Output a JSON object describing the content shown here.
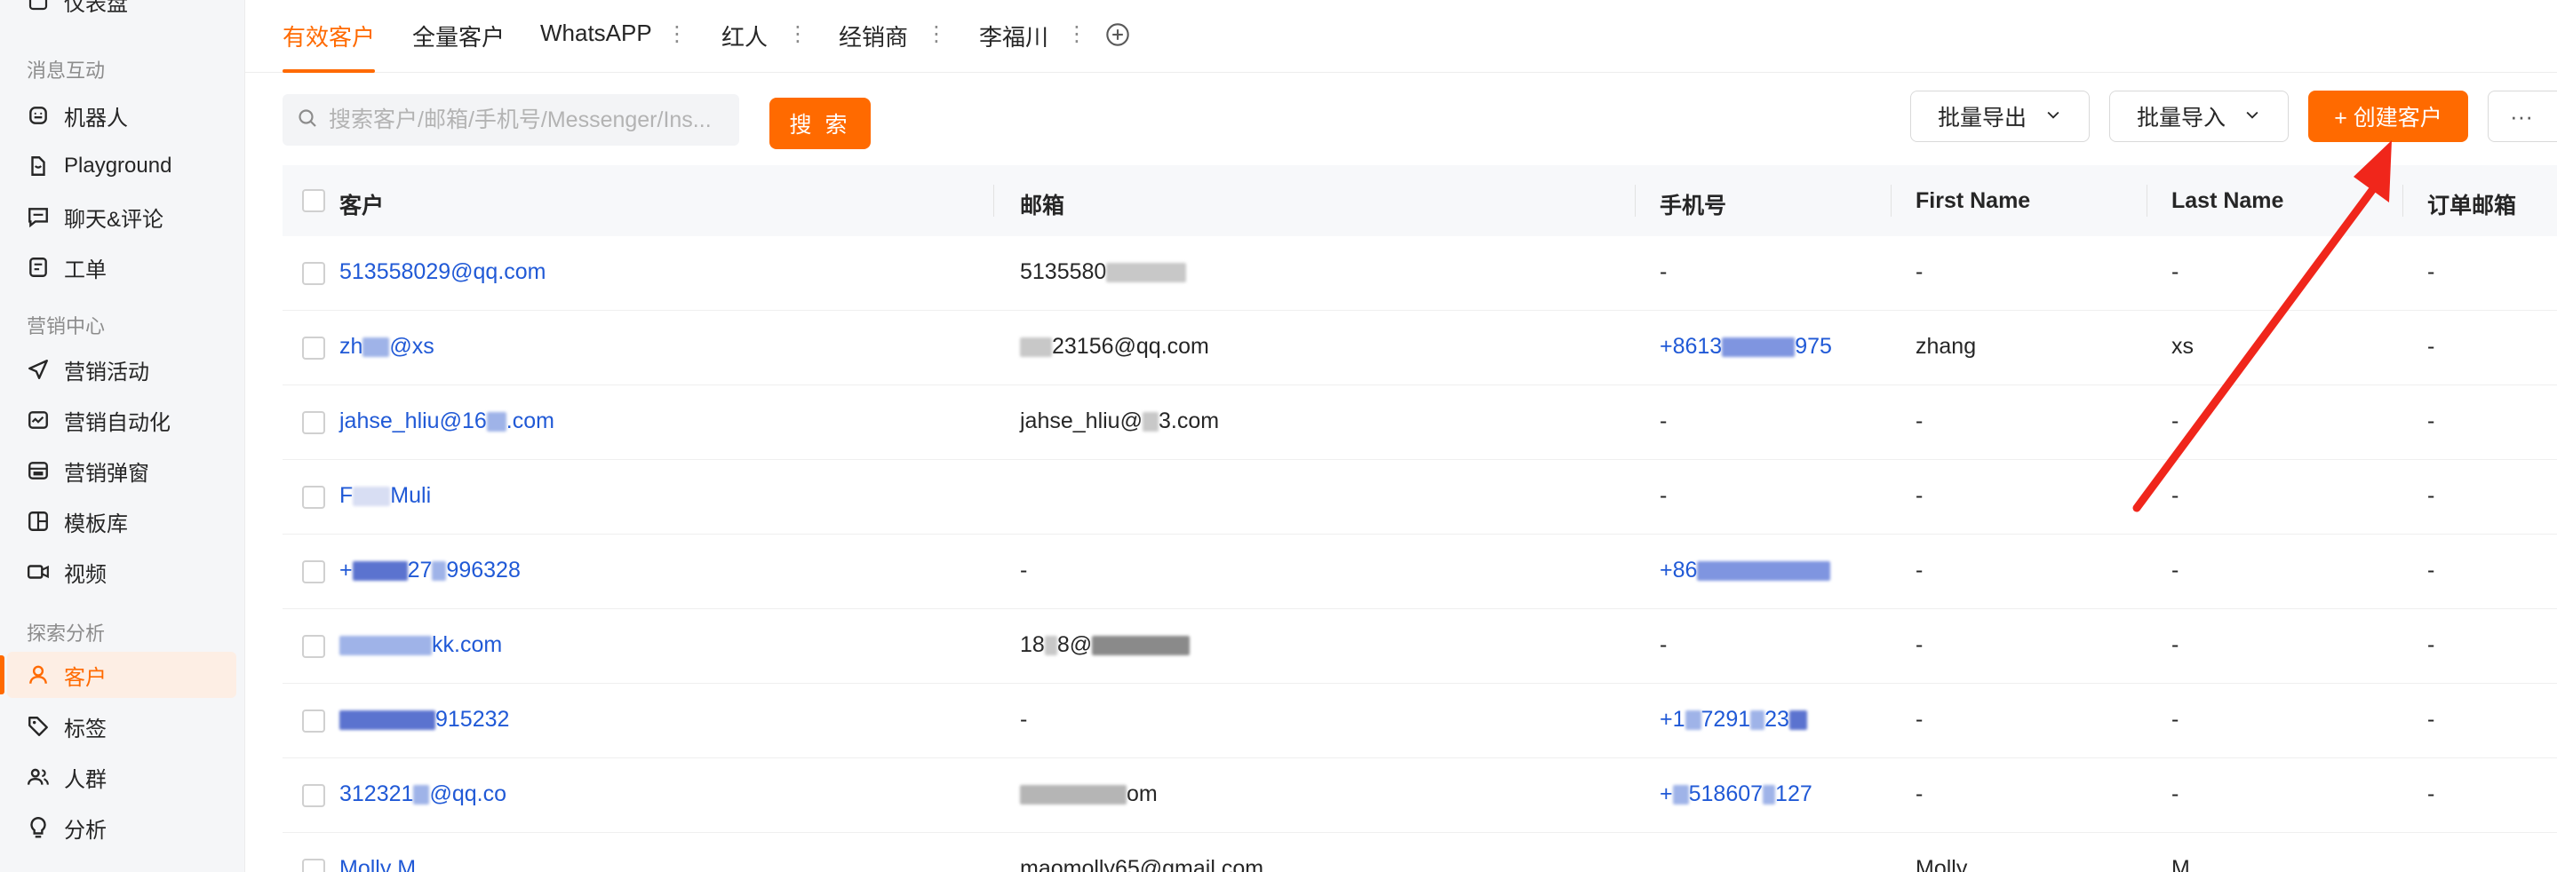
{
  "sidebar": {
    "top_cut_item": "仪表盘",
    "groups": [
      {
        "label": "消息互动",
        "items": [
          {
            "label": "机器人",
            "icon": "robot-icon"
          },
          {
            "label": "Playground",
            "icon": "playground-icon"
          },
          {
            "label": "聊天&评论",
            "icon": "chat-icon"
          },
          {
            "label": "工单",
            "icon": "ticket-icon"
          }
        ]
      },
      {
        "label": "营销中心",
        "items": [
          {
            "label": "营销活动",
            "icon": "send-icon"
          },
          {
            "label": "营销自动化",
            "icon": "automation-icon"
          },
          {
            "label": "营销弹窗",
            "icon": "popup-icon"
          },
          {
            "label": "模板库",
            "icon": "template-icon"
          },
          {
            "label": "视频",
            "icon": "video-icon"
          }
        ]
      },
      {
        "label": "探索分析",
        "items": [
          {
            "label": "客户",
            "icon": "user-icon",
            "active": true
          },
          {
            "label": "标签",
            "icon": "tag-icon"
          },
          {
            "label": "人群",
            "icon": "group-icon"
          },
          {
            "label": "分析",
            "icon": "bulb-icon"
          }
        ]
      }
    ]
  },
  "tabs": [
    {
      "label": "有效客户",
      "active": true
    },
    {
      "label": "全量客户"
    },
    {
      "label": "WhatsAPP"
    },
    {
      "label": "红人"
    },
    {
      "label": "经销商"
    },
    {
      "label": "李福川"
    }
  ],
  "toolbar": {
    "search_placeholder": "搜索客户/邮箱/手机号/Messenger/Ins...",
    "search_button": "搜 索",
    "export_label": "批量导出",
    "import_label": "批量导入",
    "create_label": "+ 创建客户",
    "more_label": "···"
  },
  "table": {
    "columns": [
      "客户",
      "邮箱",
      "手机号",
      "First Name",
      "Last Name",
      "订单邮箱"
    ],
    "rows": [
      {
        "customer": "513558029@qq.com",
        "email": "5135580",
        "email2": "",
        "phone": "-",
        "first": "-",
        "last": "-",
        "order": "-"
      },
      {
        "customer": "zh",
        "customer2": "@xs",
        "email": "",
        "email2": "23156@qq.com",
        "phone": "+8613",
        "phone2": "975",
        "first": "zhang",
        "last": "xs",
        "order": "-"
      },
      {
        "customer": "jahse_hliu@16",
        "customer2": ".com",
        "email": "jahse_hliu@",
        "email2": "3.com",
        "phone": "-",
        "first": "-",
        "last": "-",
        "order": "-"
      },
      {
        "customer": "F",
        "customer2": "Muli",
        "email": "",
        "email2": "",
        "phone": "-",
        "first": "-",
        "last": "-",
        "order": "-"
      },
      {
        "customer": "+",
        "customer2": "27",
        "customer3": "996328",
        "email": "-",
        "email2": "",
        "phone": "+86",
        "phone2": "",
        "first": "-",
        "last": "-",
        "order": "-"
      },
      {
        "customer": "",
        "customer2": "kk.com",
        "email": "18",
        "email2": "8@",
        "phone": "-",
        "first": "-",
        "last": "-",
        "order": "-"
      },
      {
        "customer": "",
        "customer2": "915232",
        "email": "-",
        "email2": "",
        "phone": "+1",
        "phone2": "7291",
        "phone3": "23",
        "first": "-",
        "last": "-",
        "order": "-"
      },
      {
        "customer": "312321",
        "customer2": "@qq.co",
        "email": "",
        "email2": "om",
        "phone": "+",
        "phone2": "518607",
        "phone3": "127",
        "first": "-",
        "last": "-",
        "order": "-"
      },
      {
        "customer": "Molly M",
        "email": "maomolly65@gmail.com",
        "phone": "",
        "first": "Molly",
        "last": "M",
        "order": ""
      }
    ]
  },
  "colors": {
    "accent": "#ff6a00",
    "link": "#2059d6",
    "sidebar_bg": "#f5f6f8",
    "arrow": "#f0261b"
  }
}
